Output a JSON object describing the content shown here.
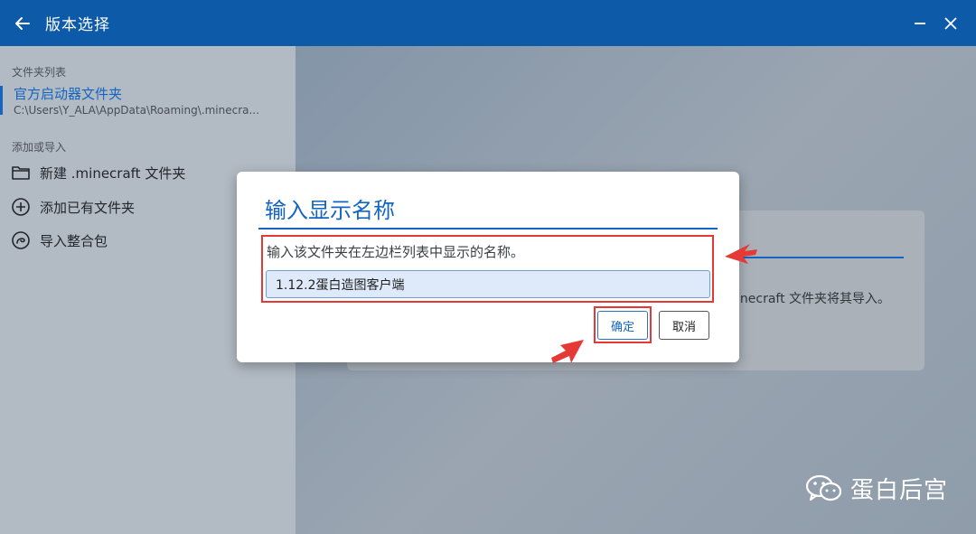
{
  "titlebar": {
    "title": "版本选择",
    "back_icon": "arrow-left-icon",
    "minimize_icon": "minimize-icon",
    "close_icon": "close-icon"
  },
  "sidebar": {
    "folder_section_title": "文件夹列表",
    "folders": [
      {
        "name": "官方启动器文件夹",
        "path": "C:\\Users\\Y_ALA\\AppData\\Roaming\\.minecra..."
      }
    ],
    "add_section_title": "添加或导入",
    "actions": [
      {
        "label": "新建 .minecraft 文件夹",
        "icon": "folder-icon"
      },
      {
        "label": "添加已有文件夹",
        "icon": "plus-circle-icon"
      },
      {
        "label": "导入整合包",
        "icon": "package-icon"
      }
    ]
  },
  "background_card": {
    "text": "inecraft 文件夹将其导入。"
  },
  "dialog": {
    "title": "输入显示名称",
    "description": "输入该文件夹在左边栏列表中显示的名称。",
    "input_value": "1.12.2蛋白造图客户端",
    "ok_label": "确定",
    "cancel_label": "取消"
  },
  "watermark": {
    "text": "蛋白后宫",
    "icon": "wechat-icon"
  },
  "colors": {
    "accent": "#1565c0",
    "titlebar": "#0d5aa8",
    "highlight": "#e53935"
  }
}
